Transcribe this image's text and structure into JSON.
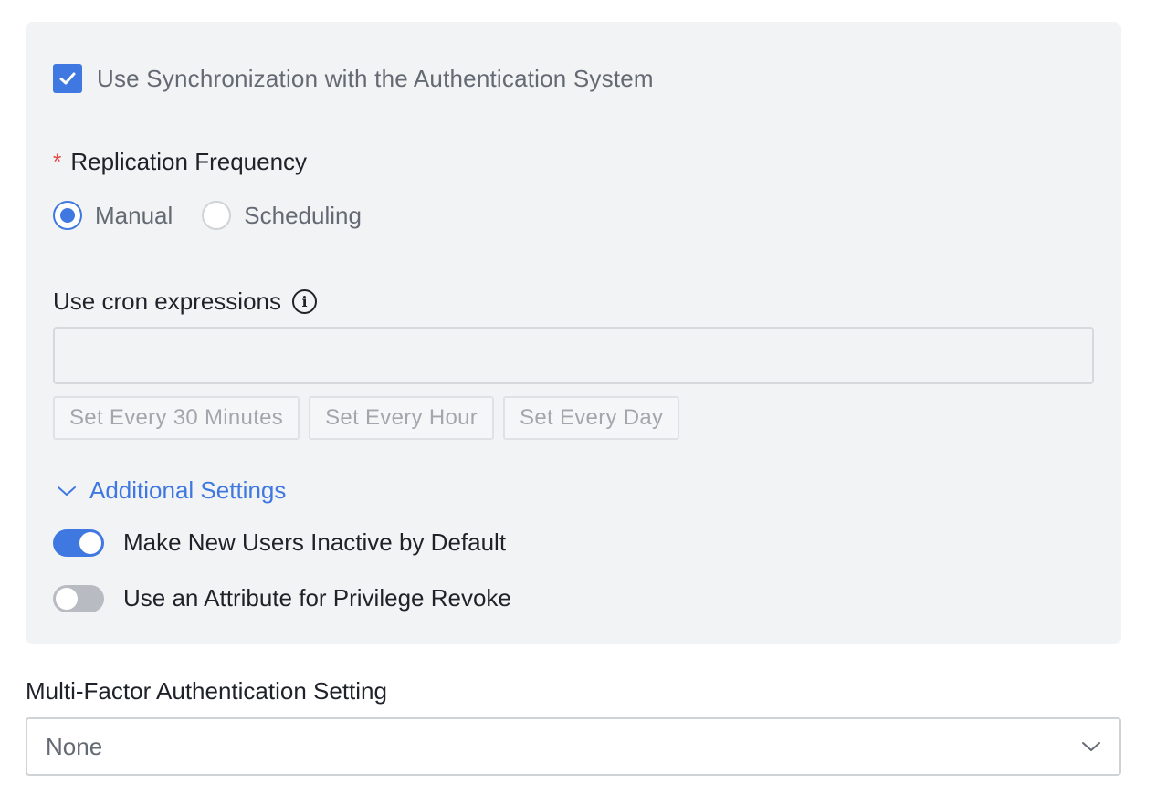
{
  "sync": {
    "label": "Use Synchronization with the Authentication System",
    "checked": true
  },
  "replication": {
    "required_mark": "*",
    "title": "Replication Frequency",
    "options": [
      {
        "label": "Manual",
        "selected": true
      },
      {
        "label": "Scheduling",
        "selected": false
      }
    ]
  },
  "cron": {
    "title": "Use cron expressions",
    "value": "",
    "presets": [
      "Set Every 30 Minutes",
      "Set Every Hour",
      "Set Every Day"
    ]
  },
  "additional": {
    "label": "Additional Settings",
    "expanded": true,
    "toggles": [
      {
        "label": "Make New Users Inactive by Default",
        "on": true
      },
      {
        "label": "Use an Attribute for Privilege Revoke",
        "on": false
      }
    ]
  },
  "mfa": {
    "title": "Multi-Factor Authentication Setting",
    "value": "None"
  },
  "colors": {
    "accent": "#3f78e0",
    "required": "#e54545",
    "panel_bg": "#f2f3f5"
  },
  "icons": {
    "checkbox": "check-icon",
    "info": "info-icon",
    "expand": "chevron-down-icon",
    "select": "chevron-down-icon"
  }
}
